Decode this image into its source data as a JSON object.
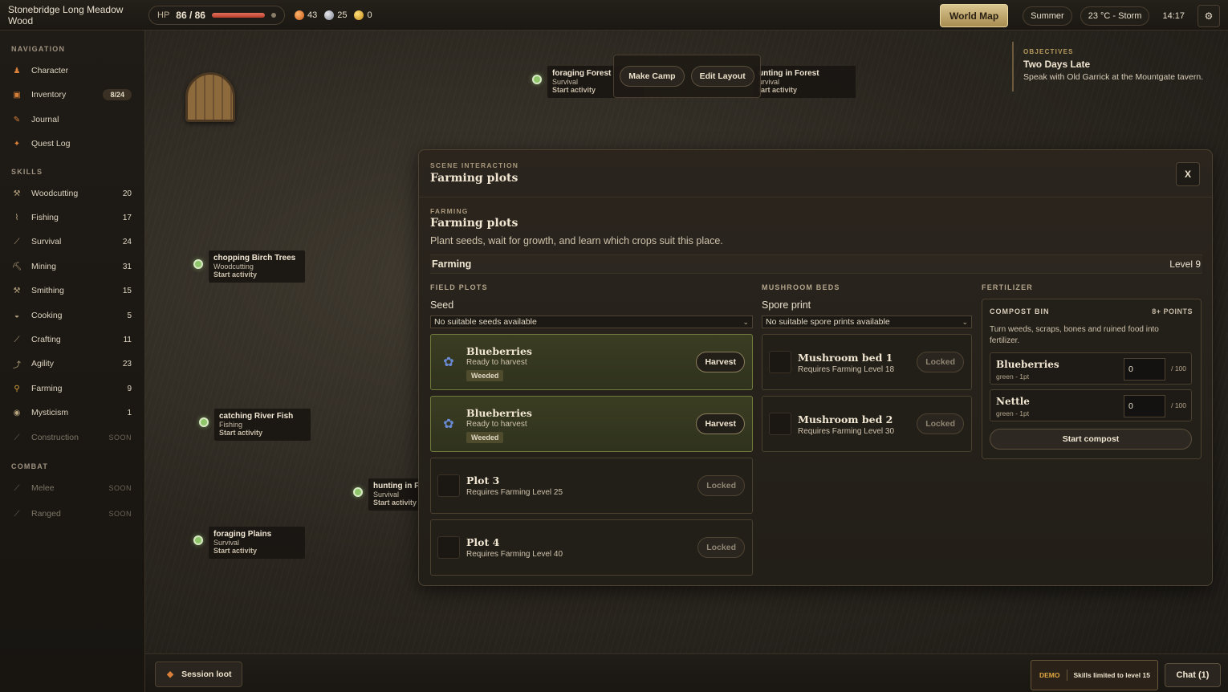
{
  "topbar": {
    "location": "Stonebridge Long Meadow Wood",
    "hp_label": "HP",
    "hp_value": "86 / 86",
    "hp_fraction": 1.0,
    "currencies": [
      {
        "icon": "copper-coin-icon",
        "value": "43"
      },
      {
        "icon": "silver-coin-icon",
        "value": "25"
      },
      {
        "icon": "gold-coin-icon",
        "value": "0"
      }
    ],
    "world_map": "World Map",
    "season": "Summer",
    "weather": "23 °C - Storm",
    "time": "14:17"
  },
  "sidebar": {
    "navigation_title": "NAVIGATION",
    "navigation": [
      {
        "label": "Character",
        "icon": "character-icon"
      },
      {
        "label": "Inventory",
        "icon": "backpack-icon",
        "badge": "8/24"
      },
      {
        "label": "Journal",
        "icon": "journal-icon"
      },
      {
        "label": "Quest Log",
        "icon": "quest-icon"
      }
    ],
    "skills_title": "SKILLS",
    "skills": [
      {
        "label": "Woodcutting",
        "level": "20"
      },
      {
        "label": "Fishing",
        "level": "17"
      },
      {
        "label": "Survival",
        "level": "24"
      },
      {
        "label": "Mining",
        "level": "31"
      },
      {
        "label": "Smithing",
        "level": "15"
      },
      {
        "label": "Cooking",
        "level": "5"
      },
      {
        "label": "Crafting",
        "level": "11"
      },
      {
        "label": "Agility",
        "level": "23"
      },
      {
        "label": "Farming",
        "level": "9"
      },
      {
        "label": "Mysticism",
        "level": "1"
      },
      {
        "label": "Construction",
        "level": "SOON"
      }
    ],
    "combat_title": "COMBAT",
    "combat": [
      {
        "label": "Melee",
        "level": "SOON"
      },
      {
        "label": "Ranged",
        "level": "SOON"
      }
    ]
  },
  "scene": {
    "activities": [
      {
        "title": "foraging Forest",
        "skill": "Survival",
        "cta": "Start activity"
      },
      {
        "title": "unting in Forest",
        "skill": "urvival",
        "cta": "tart activity"
      },
      {
        "title": "chopping Birch Trees",
        "skill": "Woodcutting",
        "cta": "Start activity"
      },
      {
        "title": "catching River Fish",
        "skill": "Fishing",
        "cta": "Start activity"
      },
      {
        "title": "hunting in F",
        "skill": "Survival",
        "cta": "Start activity"
      },
      {
        "title": "foraging Plains",
        "skill": "Survival",
        "cta": "Start activity"
      }
    ],
    "camp_actions": {
      "make_camp": "Make Camp",
      "edit_layout": "Edit Layout"
    },
    "objectives": {
      "title": "OBJECTIVES",
      "name": "Two Days Late",
      "description": "Speak with Old Garrick at the Mountgate tavern."
    }
  },
  "panel": {
    "kicker": "SCENE INTERACTION",
    "title": "Farming plots",
    "close": "X",
    "section_kicker": "FARMING",
    "section_title": "Farming plots",
    "description": "Plant seeds, wait for growth, and learn which crops suit this place.",
    "skill_name": "Farming",
    "skill_level": "Level 9",
    "field_plots": {
      "heading": "FIELD PLOTS",
      "label": "Seed",
      "select_value": "No suitable seeds available",
      "plots": [
        {
          "name": "Blueberries",
          "status": "Ready to harvest",
          "tag": "Weeded",
          "action": "Harvest",
          "ready": true
        },
        {
          "name": "Blueberries",
          "status": "Ready to harvest",
          "tag": "Weeded",
          "action": "Harvest",
          "ready": true
        },
        {
          "name": "Plot 3",
          "status": "Requires Farming Level 25",
          "action": "Locked",
          "ready": false
        },
        {
          "name": "Plot 4",
          "status": "Requires Farming Level 40",
          "action": "Locked",
          "ready": false
        }
      ]
    },
    "mushroom_beds": {
      "heading": "MUSHROOM BEDS",
      "label": "Spore print",
      "select_value": "No suitable spore prints available",
      "beds": [
        {
          "name": "Mushroom bed 1",
          "status": "Requires Farming Level 18",
          "action": "Locked"
        },
        {
          "name": "Mushroom bed 2",
          "status": "Requires Farming Level 30",
          "action": "Locked"
        }
      ]
    },
    "fertilizer": {
      "heading": "FERTILIZER",
      "bin_title": "COMPOST BIN",
      "points": "8+ POINTS",
      "description": "Turn weeds, scraps, bones and ruined food into fertilizer.",
      "items": [
        {
          "name": "Blueberries",
          "sub": "green - 1pt",
          "qty": "0",
          "max": "/ 100"
        },
        {
          "name": "Nettle",
          "sub": "green - 1pt",
          "qty": "0",
          "max": "/ 100"
        }
      ],
      "start": "Start compost"
    }
  },
  "bottombar": {
    "session_loot": "Session loot",
    "demo": "DEMO",
    "demo_note": "Skills limited to level 15",
    "chat": "Chat (1)"
  },
  "colors": {
    "accent_gold": "#d9c58f",
    "ready_green": "#6f7a3c",
    "activity_dot": "#8fc66a",
    "hp_red": "#e2705a",
    "demo_orange": "#e0a540"
  }
}
